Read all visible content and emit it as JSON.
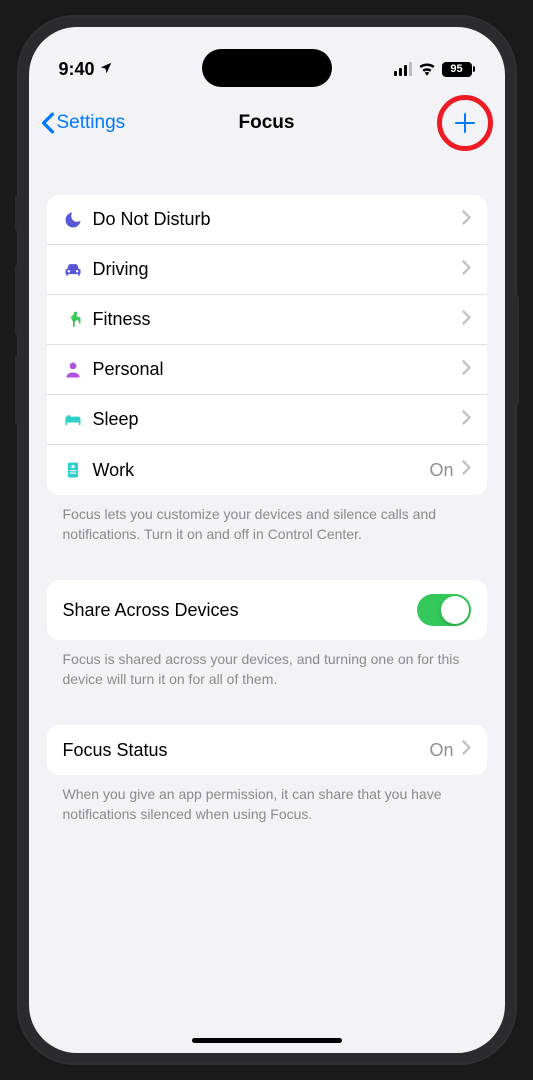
{
  "statusBar": {
    "time": "9:40",
    "battery": "95"
  },
  "nav": {
    "back": "Settings",
    "title": "Focus"
  },
  "focusModes": [
    {
      "label": "Do Not Disturb",
      "iconColor": "#5856d6",
      "value": ""
    },
    {
      "label": "Driving",
      "iconColor": "#5856d6",
      "value": ""
    },
    {
      "label": "Fitness",
      "iconColor": "#34c759",
      "value": ""
    },
    {
      "label": "Personal",
      "iconColor": "#af52de",
      "value": ""
    },
    {
      "label": "Sleep",
      "iconColor": "#2fd0c9",
      "value": ""
    },
    {
      "label": "Work",
      "iconColor": "#2fd0c9",
      "value": "On"
    }
  ],
  "footerFocus": "Focus lets you customize your devices and silence calls and notifications. Turn it on and off in Control Center.",
  "shareRow": {
    "label": "Share Across Devices"
  },
  "footerShare": "Focus is shared across your devices, and turning one on for this device will turn it on for all of them.",
  "statusRow": {
    "label": "Focus Status",
    "value": "On"
  },
  "footerStatus": "When you give an app permission, it can share that you have notifications silenced when using Focus."
}
